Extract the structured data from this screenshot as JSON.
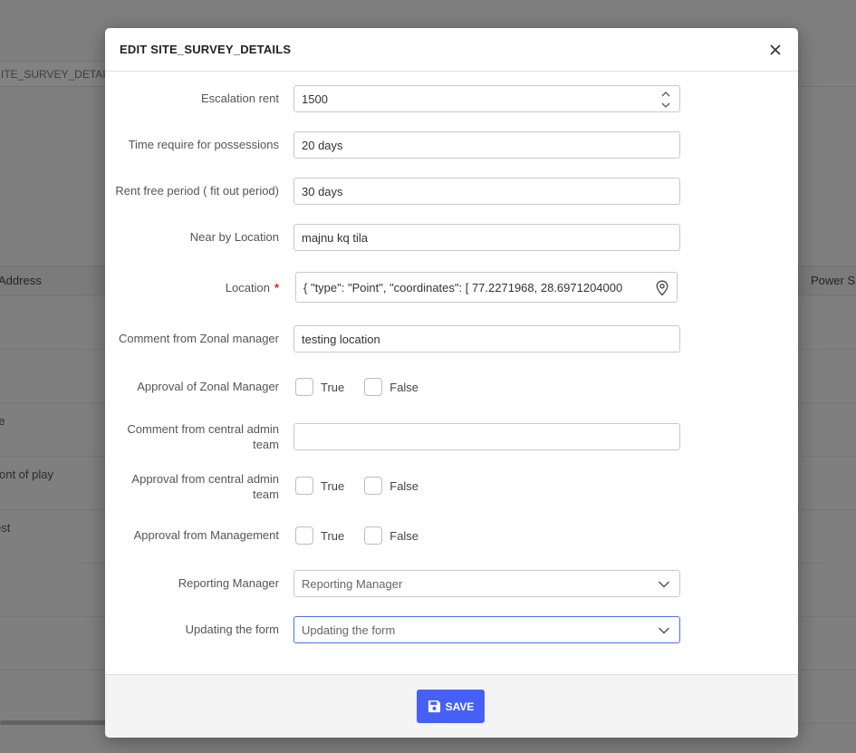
{
  "background": {
    "tab_label": "ITE_SURVEY_DETAIL",
    "columns": [
      "Address",
      "Power S"
    ],
    "row_fragments": [
      "re",
      "ont of play",
      "est"
    ]
  },
  "modal": {
    "title": "EDIT SITE_SURVEY_DETAILS",
    "fields": {
      "escalation_rent": {
        "label": "Escalation rent",
        "value": "1500"
      },
      "time_possession": {
        "label": "Time require for possessions",
        "value": "20 days"
      },
      "rent_free": {
        "label": "Rent free period ( fit out period)",
        "value": "30 days"
      },
      "near_by": {
        "label": "Near by Location",
        "value": "majnu kq tila"
      },
      "location": {
        "label": "Location",
        "required_mark": "*",
        "value": "{  \"type\": \"Point\",  \"coordinates\": [    77.2271968,    28.6971204000"
      },
      "zonal_comment": {
        "label": "Comment from Zonal manager",
        "value": "testing location"
      },
      "zonal_approval": {
        "label": "Approval of Zonal Manager",
        "true_label": "True",
        "false_label": "False"
      },
      "central_comment": {
        "label_line1": "Comment from central admin",
        "label_line2": "team",
        "value": ""
      },
      "central_approval": {
        "label_line1": "Approval from central admin",
        "label_line2": "team",
        "true_label": "True",
        "false_label": "False"
      },
      "mgmt_approval": {
        "label": "Approval from Management",
        "true_label": "True",
        "false_label": "False"
      },
      "reporting_manager": {
        "label": "Reporting Manager",
        "placeholder": "Reporting Manager"
      },
      "updating_form": {
        "label": "Updating the form",
        "placeholder": "Updating the form"
      }
    },
    "save_label": "SAVE"
  },
  "colors": {
    "primary": "#4561f5",
    "required": "#e02020",
    "focus": "#4a70ee"
  }
}
